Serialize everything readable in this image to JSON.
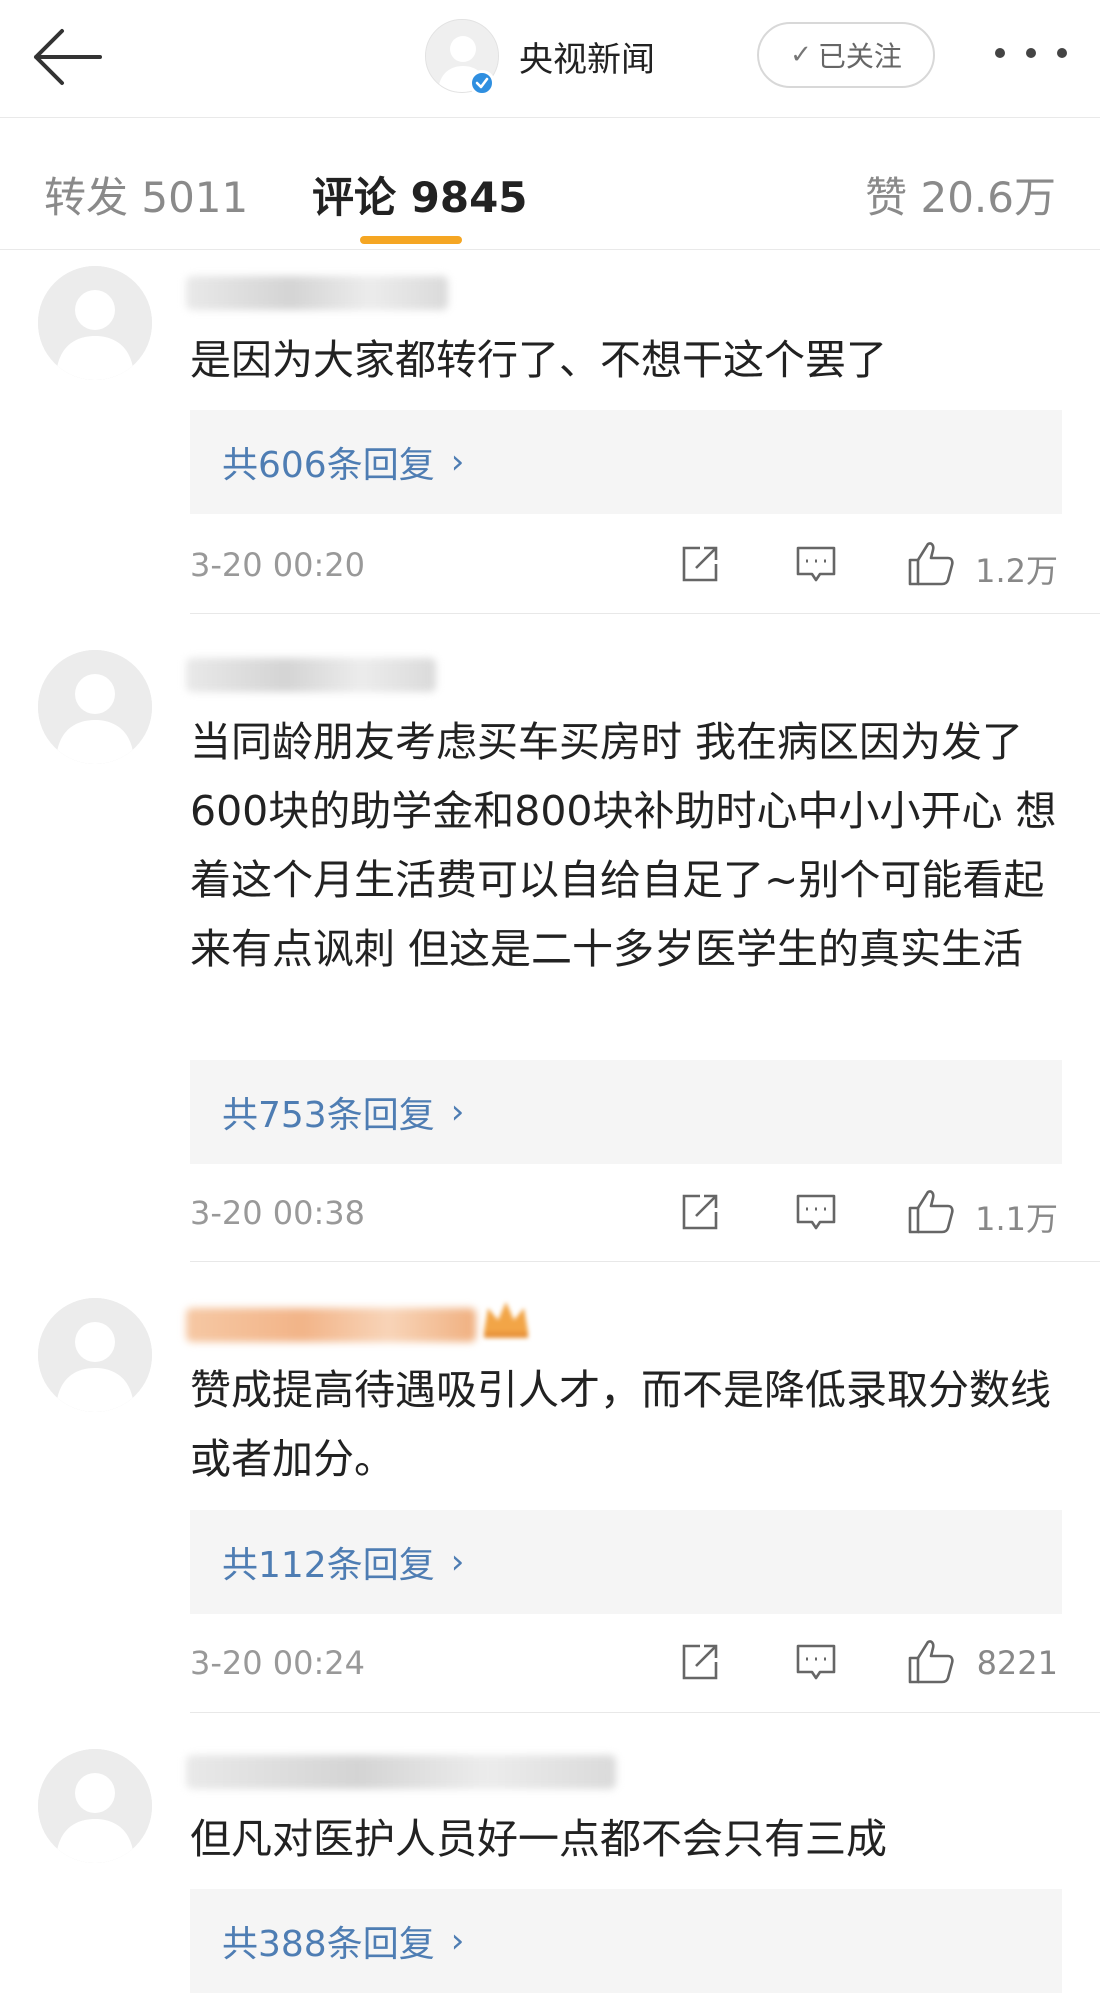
{
  "header": {
    "back_icon": "arrow-left-icon",
    "account_name": "央视新闻",
    "verified_icon": "verified-badge-icon",
    "follow_label": "已关注",
    "more_icon": "more-dots-icon"
  },
  "tabs": {
    "repost": "转发 5011",
    "comment": "评论 9845",
    "like": "赞 20.6万",
    "active": "comment",
    "accent_color": "#f5a623"
  },
  "colors": {
    "reply_link": "#4e7db3",
    "meta_text": "#999999"
  },
  "comments": [
    {
      "text": "是因为大家都转行了、不想干这个罢了",
      "replies": "共606条回复",
      "time": "3-20 00:20",
      "likes": "1.2万"
    },
    {
      "text": "当同龄朋友考虑买车买房时 我在病区因为发了600块的助学金和800块补助时心中小小开心 想着这个月生活费可以自给自足了~别个可能看起来有点讽刺 但这是二十多岁医学生的真实生活",
      "replies": "共753条回复",
      "time": "3-20 00:38",
      "likes": "1.1万"
    },
    {
      "text": "赞成提高待遇吸引人才，而不是降低录取分数线或者加分。",
      "replies": "共112条回复",
      "time": "3-20 00:24",
      "likes": "8221"
    },
    {
      "text": "但凡对医护人员好一点都不会只有三成",
      "replies": "共388条回复"
    }
  ]
}
